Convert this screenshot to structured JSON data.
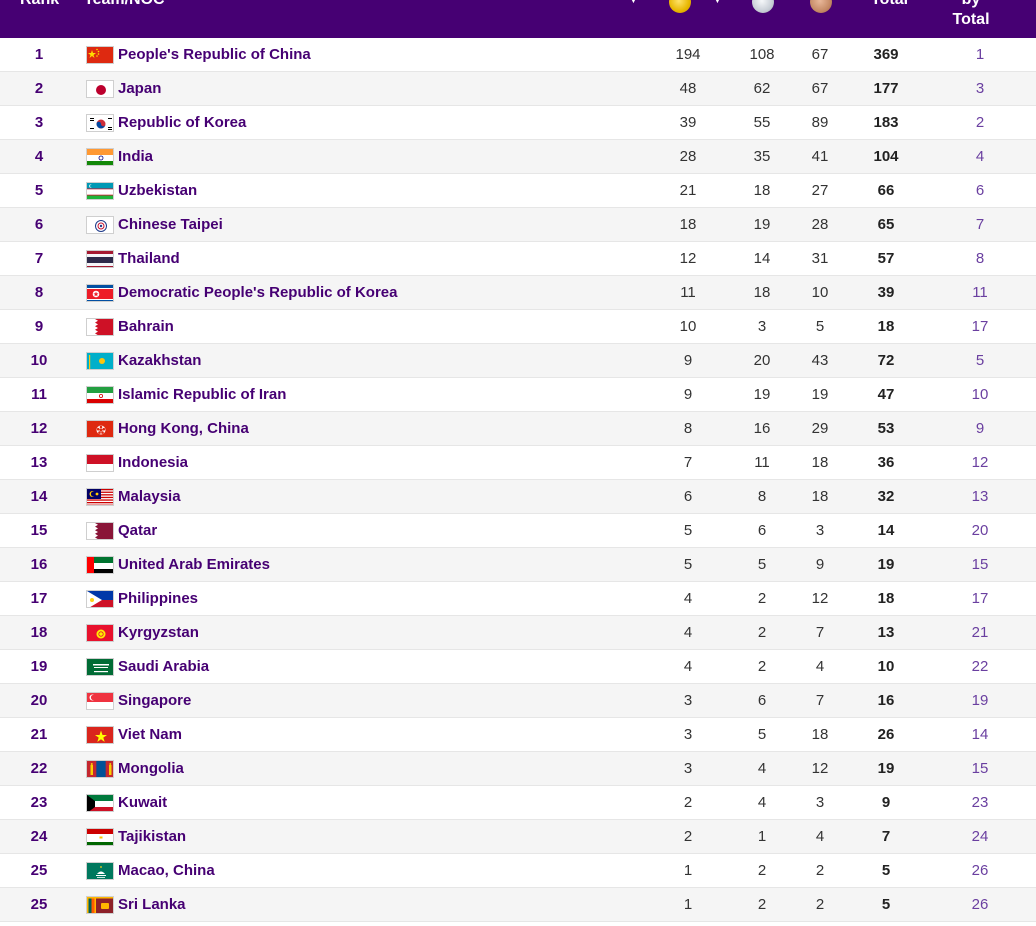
{
  "header": {
    "rank": "Rank",
    "team": "Team/NOC",
    "total": "Total",
    "rank_by_line1": "by",
    "rank_by_line2": "Total",
    "medal_icons": [
      "gold-medal-icon",
      "silver-medal-icon",
      "bronze-medal-icon"
    ],
    "sort_icon": "chevron-down-icon"
  },
  "theme": {
    "header_bg": "#460073",
    "name_color": "#460073",
    "rank_by_total_color": "#6a3fa0",
    "alt_row_bg": "#f5f5f5"
  },
  "rows": [
    {
      "rank": "1",
      "flag": "china-flag-icon",
      "name": "People's Republic of China",
      "gold": "194",
      "silver": "108",
      "bronze": "67",
      "total": "369",
      "rank_total": "1"
    },
    {
      "rank": "2",
      "flag": "japan-flag-icon",
      "name": "Japan",
      "gold": "48",
      "silver": "62",
      "bronze": "67",
      "total": "177",
      "rank_total": "3"
    },
    {
      "rank": "3",
      "flag": "korea-flag-icon",
      "name": "Republic of Korea",
      "gold": "39",
      "silver": "55",
      "bronze": "89",
      "total": "183",
      "rank_total": "2"
    },
    {
      "rank": "4",
      "flag": "india-flag-icon",
      "name": "India",
      "gold": "28",
      "silver": "35",
      "bronze": "41",
      "total": "104",
      "rank_total": "4"
    },
    {
      "rank": "5",
      "flag": "uzbekistan-flag-icon",
      "name": "Uzbekistan",
      "gold": "21",
      "silver": "18",
      "bronze": "27",
      "total": "66",
      "rank_total": "6"
    },
    {
      "rank": "6",
      "flag": "chinese-taipei-flag-icon",
      "name": "Chinese Taipei",
      "gold": "18",
      "silver": "19",
      "bronze": "28",
      "total": "65",
      "rank_total": "7"
    },
    {
      "rank": "7",
      "flag": "thailand-flag-icon",
      "name": "Thailand",
      "gold": "12",
      "silver": "14",
      "bronze": "31",
      "total": "57",
      "rank_total": "8"
    },
    {
      "rank": "8",
      "flag": "dprk-flag-icon",
      "name": "Democratic People's Republic of Korea",
      "gold": "11",
      "silver": "18",
      "bronze": "10",
      "total": "39",
      "rank_total": "11"
    },
    {
      "rank": "9",
      "flag": "bahrain-flag-icon",
      "name": "Bahrain",
      "gold": "10",
      "silver": "3",
      "bronze": "5",
      "total": "18",
      "rank_total": "17"
    },
    {
      "rank": "10",
      "flag": "kazakhstan-flag-icon",
      "name": "Kazakhstan",
      "gold": "9",
      "silver": "20",
      "bronze": "43",
      "total": "72",
      "rank_total": "5"
    },
    {
      "rank": "11",
      "flag": "iran-flag-icon",
      "name": "Islamic Republic of Iran",
      "gold": "9",
      "silver": "19",
      "bronze": "19",
      "total": "47",
      "rank_total": "10"
    },
    {
      "rank": "12",
      "flag": "hong-kong-flag-icon",
      "name": "Hong Kong, China",
      "gold": "8",
      "silver": "16",
      "bronze": "29",
      "total": "53",
      "rank_total": "9"
    },
    {
      "rank": "13",
      "flag": "indonesia-flag-icon",
      "name": "Indonesia",
      "gold": "7",
      "silver": "11",
      "bronze": "18",
      "total": "36",
      "rank_total": "12"
    },
    {
      "rank": "14",
      "flag": "malaysia-flag-icon",
      "name": "Malaysia",
      "gold": "6",
      "silver": "8",
      "bronze": "18",
      "total": "32",
      "rank_total": "13"
    },
    {
      "rank": "15",
      "flag": "qatar-flag-icon",
      "name": "Qatar",
      "gold": "5",
      "silver": "6",
      "bronze": "3",
      "total": "14",
      "rank_total": "20"
    },
    {
      "rank": "16",
      "flag": "uae-flag-icon",
      "name": "United Arab Emirates",
      "gold": "5",
      "silver": "5",
      "bronze": "9",
      "total": "19",
      "rank_total": "15"
    },
    {
      "rank": "17",
      "flag": "philippines-flag-icon",
      "name": "Philippines",
      "gold": "4",
      "silver": "2",
      "bronze": "12",
      "total": "18",
      "rank_total": "17"
    },
    {
      "rank": "18",
      "flag": "kyrgyzstan-flag-icon",
      "name": "Kyrgyzstan",
      "gold": "4",
      "silver": "2",
      "bronze": "7",
      "total": "13",
      "rank_total": "21"
    },
    {
      "rank": "19",
      "flag": "saudi-arabia-flag-icon",
      "name": "Saudi Arabia",
      "gold": "4",
      "silver": "2",
      "bronze": "4",
      "total": "10",
      "rank_total": "22"
    },
    {
      "rank": "20",
      "flag": "singapore-flag-icon",
      "name": "Singapore",
      "gold": "3",
      "silver": "6",
      "bronze": "7",
      "total": "16",
      "rank_total": "19"
    },
    {
      "rank": "21",
      "flag": "viet-nam-flag-icon",
      "name": "Viet Nam",
      "gold": "3",
      "silver": "5",
      "bronze": "18",
      "total": "26",
      "rank_total": "14"
    },
    {
      "rank": "22",
      "flag": "mongolia-flag-icon",
      "name": "Mongolia",
      "gold": "3",
      "silver": "4",
      "bronze": "12",
      "total": "19",
      "rank_total": "15"
    },
    {
      "rank": "23",
      "flag": "kuwait-flag-icon",
      "name": "Kuwait",
      "gold": "2",
      "silver": "4",
      "bronze": "3",
      "total": "9",
      "rank_total": "23"
    },
    {
      "rank": "24",
      "flag": "tajikistan-flag-icon",
      "name": "Tajikistan",
      "gold": "2",
      "silver": "1",
      "bronze": "4",
      "total": "7",
      "rank_total": "24"
    },
    {
      "rank": "25",
      "flag": "macao-flag-icon",
      "name": "Macao, China",
      "gold": "1",
      "silver": "2",
      "bronze": "2",
      "total": "5",
      "rank_total": "26"
    },
    {
      "rank": "25",
      "flag": "sri-lanka-flag-icon",
      "name": "Sri Lanka",
      "gold": "1",
      "silver": "2",
      "bronze": "2",
      "total": "5",
      "rank_total": "26"
    }
  ]
}
